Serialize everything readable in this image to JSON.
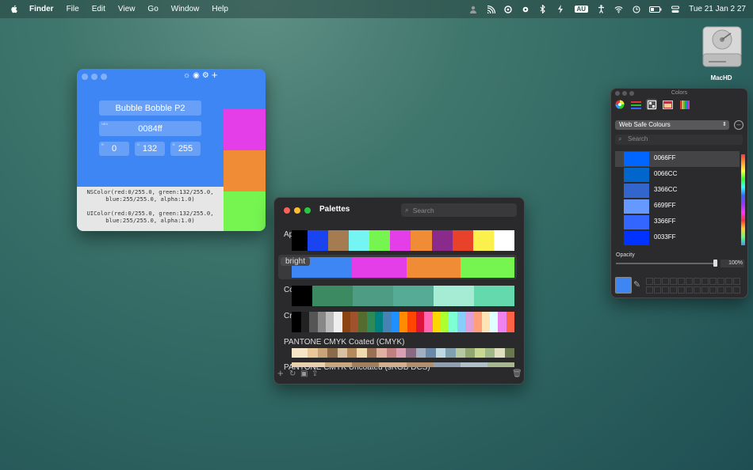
{
  "menubar": {
    "app": "Finder",
    "items": [
      "File",
      "Edit",
      "View",
      "Go",
      "Window",
      "Help"
    ],
    "keyboard": "AU",
    "clock": "Tue 21 Jan  2 27"
  },
  "desktop": {
    "disk_label": "MacHD"
  },
  "bubble": {
    "name": "Bubble Bobble P2",
    "hex": "0084ff",
    "hex_mini": "HEX",
    "r": "0",
    "g": "132",
    "b": "255",
    "r_mini": "R",
    "g_mini": "G",
    "b_mini": "B",
    "nscolor": "NSColor(red:0/255.0, green:132/255.0, blue:255/255.0, alpha:1.0)",
    "uicolor": "UIColor(red:0/255.0, green:132/255.0, blue:255/255.0, alpha:1.0)",
    "swatches": [
      "#e43ee8",
      "#ef8c35",
      "#76f551"
    ]
  },
  "palettes": {
    "title": "Palettes",
    "search_placeholder": "Search",
    "rows": [
      {
        "name": "Apple",
        "colors": [
          "#1a44f0",
          "#a57c52",
          "#75f4f4",
          "#76f551",
          "#e43ee8",
          "#ef8c35",
          "#8a2a8a",
          "#e8432a",
          "#fcf04c",
          "#ffffff"
        ],
        "lead": "#000000"
      },
      {
        "name": "bright",
        "colors": [
          "#3f86f5",
          "#e43ee8",
          "#ef8c35",
          "#76f551"
        ],
        "lead": "#3f86f5"
      },
      {
        "name": "Cookie",
        "colors": [
          "#3b8a62",
          "#4e9c84",
          "#56ab96",
          "#a6ecd4",
          "#64d9ae"
        ],
        "lead": "#000000"
      },
      {
        "name": "Crayons",
        "colors": [
          "#222",
          "#555",
          "#888",
          "#bbb",
          "#eee",
          "#8b4513",
          "#a0522d",
          "#556b2f",
          "#2e8b57",
          "#008080",
          "#4682b4",
          "#1e90ff",
          "#ff8c00",
          "#ff4500",
          "#dc143c",
          "#ff69b4",
          "#ffd700",
          "#adff2f",
          "#7fffd4",
          "#87cefa",
          "#dda0dd",
          "#ffa07a",
          "#ffe4b5",
          "#e0ffff",
          "#ee82ee",
          "#ff6347"
        ],
        "lead": "#000000"
      },
      {
        "name": "PANTONE CMYK Coated (CMYK)",
        "colors": [
          "#f5e6c8",
          "#e8c89a",
          "#c9a378",
          "#8b6b4a",
          "#d8c1a0",
          "#b58a5a",
          "#f1d9b0",
          "#9a7055",
          "#e0b0a0",
          "#c08080",
          "#d8a0b0",
          "#8a6a80",
          "#a0b0c0",
          "#6a88a8",
          "#c0d8e0",
          "#80a0b0",
          "#b8c8a0",
          "#90a870",
          "#c8d890",
          "#a0b888",
          "#e0e0c0",
          "#6a7850"
        ],
        "lead": "#f5e6c8"
      },
      {
        "name": "PANTONE CMYK Uncoated (sRGB DCS)",
        "colors": [
          "#e8d0b0",
          "#c8a880",
          "#a08060",
          "#d0b090",
          "#b09070",
          "#90a0b0",
          "#b0c0c8",
          "#a8b890"
        ],
        "lead": "#e8d0b0"
      }
    ],
    "bottom_icons": [
      "add-icon",
      "refresh-icon",
      "paste-icon",
      "share-icon",
      "trash-icon"
    ]
  },
  "colors_panel": {
    "title": "Colors",
    "list_name": "Web Safe Colours",
    "search_placeholder": "Search",
    "rows": [
      {
        "name": "0066FF",
        "color": "#0066ff"
      },
      {
        "name": "0066CC",
        "color": "#0066cc"
      },
      {
        "name": "3366CC",
        "color": "#3366cc"
      },
      {
        "name": "6699FF",
        "color": "#6699ff"
      },
      {
        "name": "3366FF",
        "color": "#3366ff"
      },
      {
        "name": "0033FF",
        "color": "#0033ff"
      }
    ],
    "opacity_label": "Opacity",
    "opacity_value": "100%",
    "current_color": "#3f86f5"
  }
}
